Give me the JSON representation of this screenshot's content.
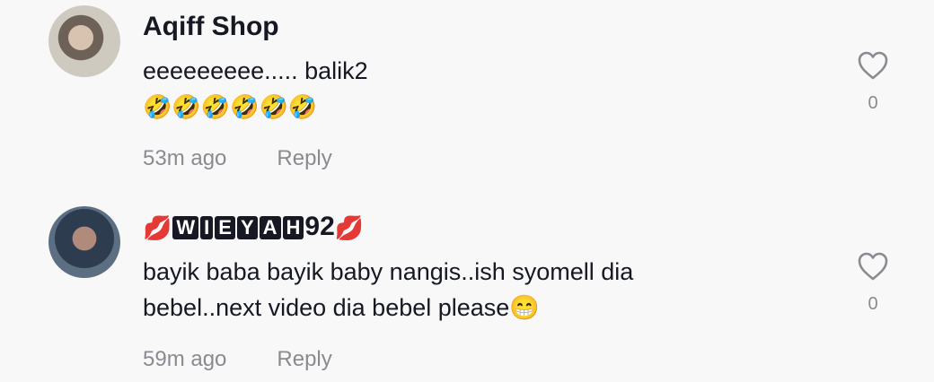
{
  "comments": [
    {
      "username": "Aqiff Shop",
      "text_line1": "eeeeeeeee..... balik2",
      "text_line2": "🤣🤣🤣🤣🤣🤣",
      "time": "53m ago",
      "reply_label": "Reply",
      "likes": "0"
    },
    {
      "username_prefix_emoji": "💋",
      "username_badges": [
        "W",
        "I",
        "E",
        "Y",
        "A",
        "H"
      ],
      "username_suffix": "92",
      "username_suffix_emoji": "💋",
      "text_line1": "bayik baba bayik baby nangis..ish syomell dia",
      "text_line2": "bebel..next video dia bebel please😁",
      "time": "59m ago",
      "reply_label": "Reply",
      "likes": "0"
    }
  ],
  "icons": {
    "like": "heart-outline-icon"
  }
}
